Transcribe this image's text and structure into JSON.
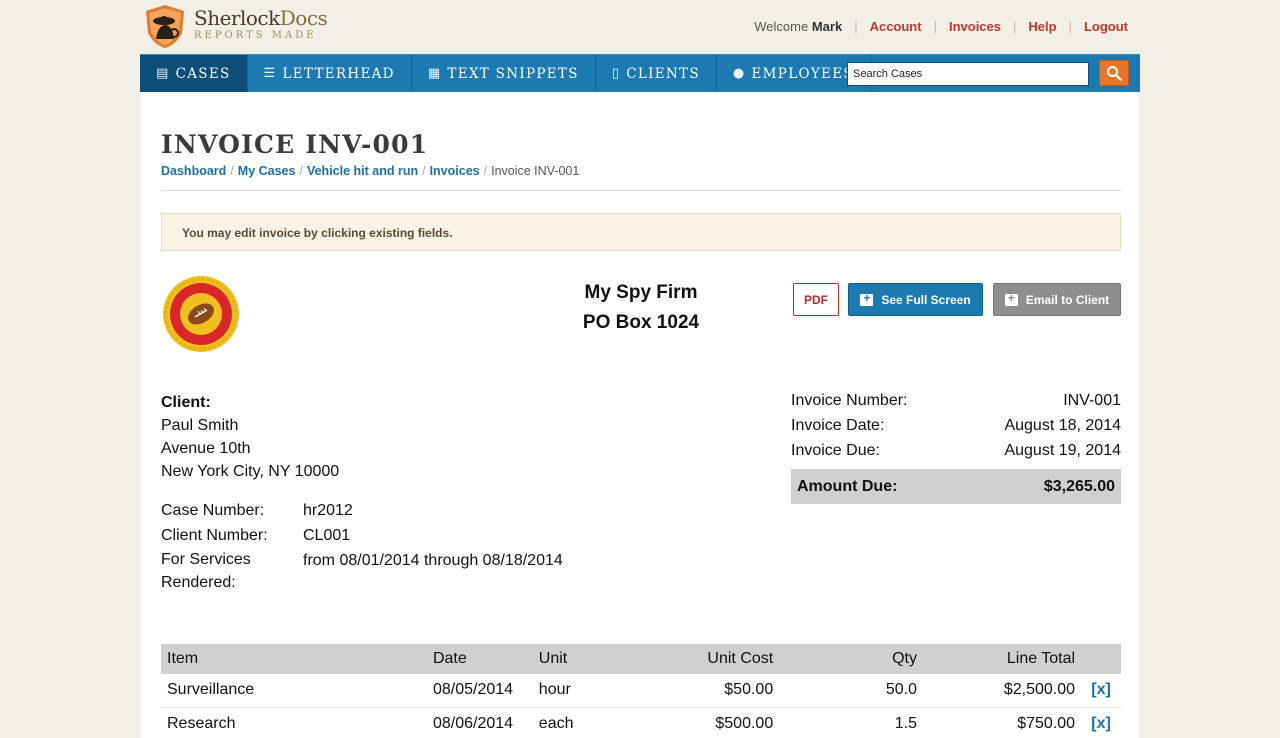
{
  "brand": {
    "name_part1": "Sherlock",
    "name_part2": "Docs",
    "tagline": "REPORTS MADE"
  },
  "header": {
    "welcome_text": "Welcome",
    "username": "Mark",
    "links": [
      "Account",
      "Invoices",
      "Help",
      "Logout"
    ]
  },
  "nav": {
    "items": [
      "CASES",
      "LETTERHEAD",
      "TEXT SNIPPETS",
      "CLIENTS",
      "EMPLOYEES"
    ],
    "active": "CASES",
    "search_value": "Search Cases"
  },
  "page": {
    "title": "INVOICE INV-001",
    "breadcrumb": [
      "Dashboard",
      "My Cases",
      "Vehicle hit and run",
      "Invoices"
    ],
    "breadcrumb_current": "Invoice INV-001",
    "notice": "You may edit invoice by clicking existing fields."
  },
  "firm": {
    "name": "My Spy Firm",
    "address": "PO Box 1024"
  },
  "buttons": {
    "pdf": "PDF",
    "full_screen": "See Full Screen",
    "email": "Email to Client"
  },
  "client": {
    "label": "Client:",
    "name": "Paul Smith",
    "address1": "Avenue 10th",
    "address2": "New York City, NY 10000"
  },
  "meta": {
    "case_number_label": "Case Number:",
    "case_number": "hr2012",
    "client_number_label": "Client Number:",
    "client_number": "CL001",
    "services_label_1": "For Services",
    "services_label_2": "Rendered:",
    "services_value": "from 08/01/2014 through 08/18/2014"
  },
  "invoice": {
    "number_label": "Invoice Number:",
    "number": "INV-001",
    "date_label": "Invoice Date:",
    "date": "August 18, 2014",
    "due_label": "Invoice Due:",
    "due": "August 19, 2014",
    "amount_label": "Amount Due:",
    "amount": "$3,265.00"
  },
  "table": {
    "headers": [
      "Item",
      "Date",
      "Unit",
      "Unit Cost",
      "Qty",
      "Line Total"
    ],
    "rows": [
      {
        "item": "Surveillance",
        "date": "08/05/2014",
        "unit": "hour",
        "cost": "$50.00",
        "qty": "50.0",
        "total": "$2,500.00",
        "remove": "[x]"
      },
      {
        "item": "Research",
        "date": "08/06/2014",
        "unit": "each",
        "cost": "$500.00",
        "qty": "1.5",
        "total": "$750.00",
        "remove": "[x]"
      }
    ]
  },
  "colors": {
    "nav": "#1d7ab0",
    "nav_active": "#0e4f7a",
    "link": "#1f6fa3",
    "header_link": "#c0392b",
    "search_button": "#e8752a"
  }
}
